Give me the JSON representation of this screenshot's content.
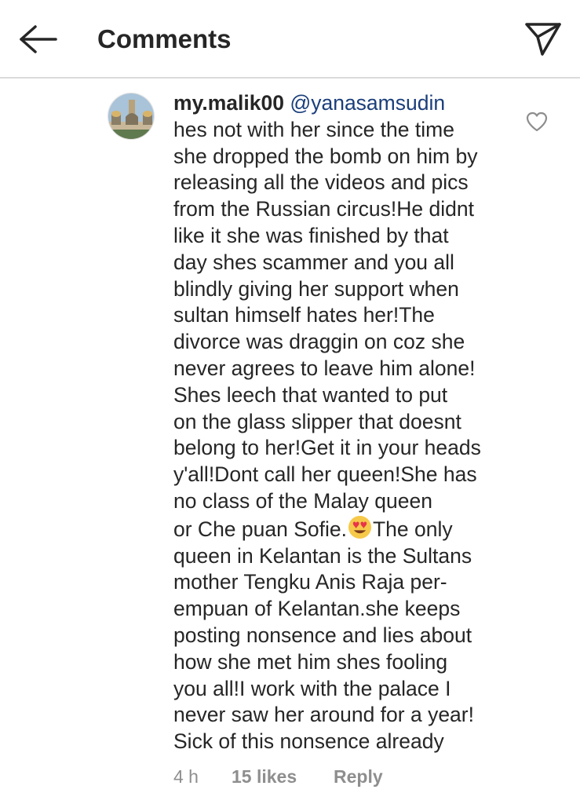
{
  "header": {
    "title": "Comments",
    "back_icon": "arrow-left-icon",
    "share_icon": "paper-plane-icon"
  },
  "comment": {
    "username": "my.malik00",
    "mention": "@yanasamsudin",
    "lines": [
      "hes not with her since the time",
      "she dropped the bomb on him by",
      "releasing all the videos and pics",
      "from the Russian circus!He didnt",
      "like it she was finished by that",
      "day shes scammer and you all",
      "blindly giving her support when",
      "sultan himself hates her!The",
      "divorce was draggin on coz she",
      "never agrees to leave him alone!",
      "Shes leech that wanted to put",
      "on the glass slipper that doesnt",
      "belong to her!Get it in your heads",
      "y'all!Dont call her queen!She has",
      "no class of the Malay queen"
    ],
    "emoji_line_before": "or Che puan Sofie.",
    "emoji_name": "heart-eyes-emoji-icon",
    "emoji_line_after": "The only",
    "lines_after": [
      "queen in Kelantan is the Sultans",
      "mother Tengku Anis Raja per-",
      "empuan of Kelantan.she keeps",
      "posting nonsence and lies about",
      "how she met him shes fooling",
      "you all!I work with the palace I",
      "never saw her around for a year!",
      "Sick of this nonsence already"
    ],
    "time": "4 h",
    "likes": "15 likes",
    "reply": "Reply",
    "like_icon": "heart-outline-icon"
  },
  "colors": {
    "text": "#262626",
    "mention": "#1a3e7a",
    "meta": "#8e8e8e",
    "divider": "#dbdbdb"
  }
}
